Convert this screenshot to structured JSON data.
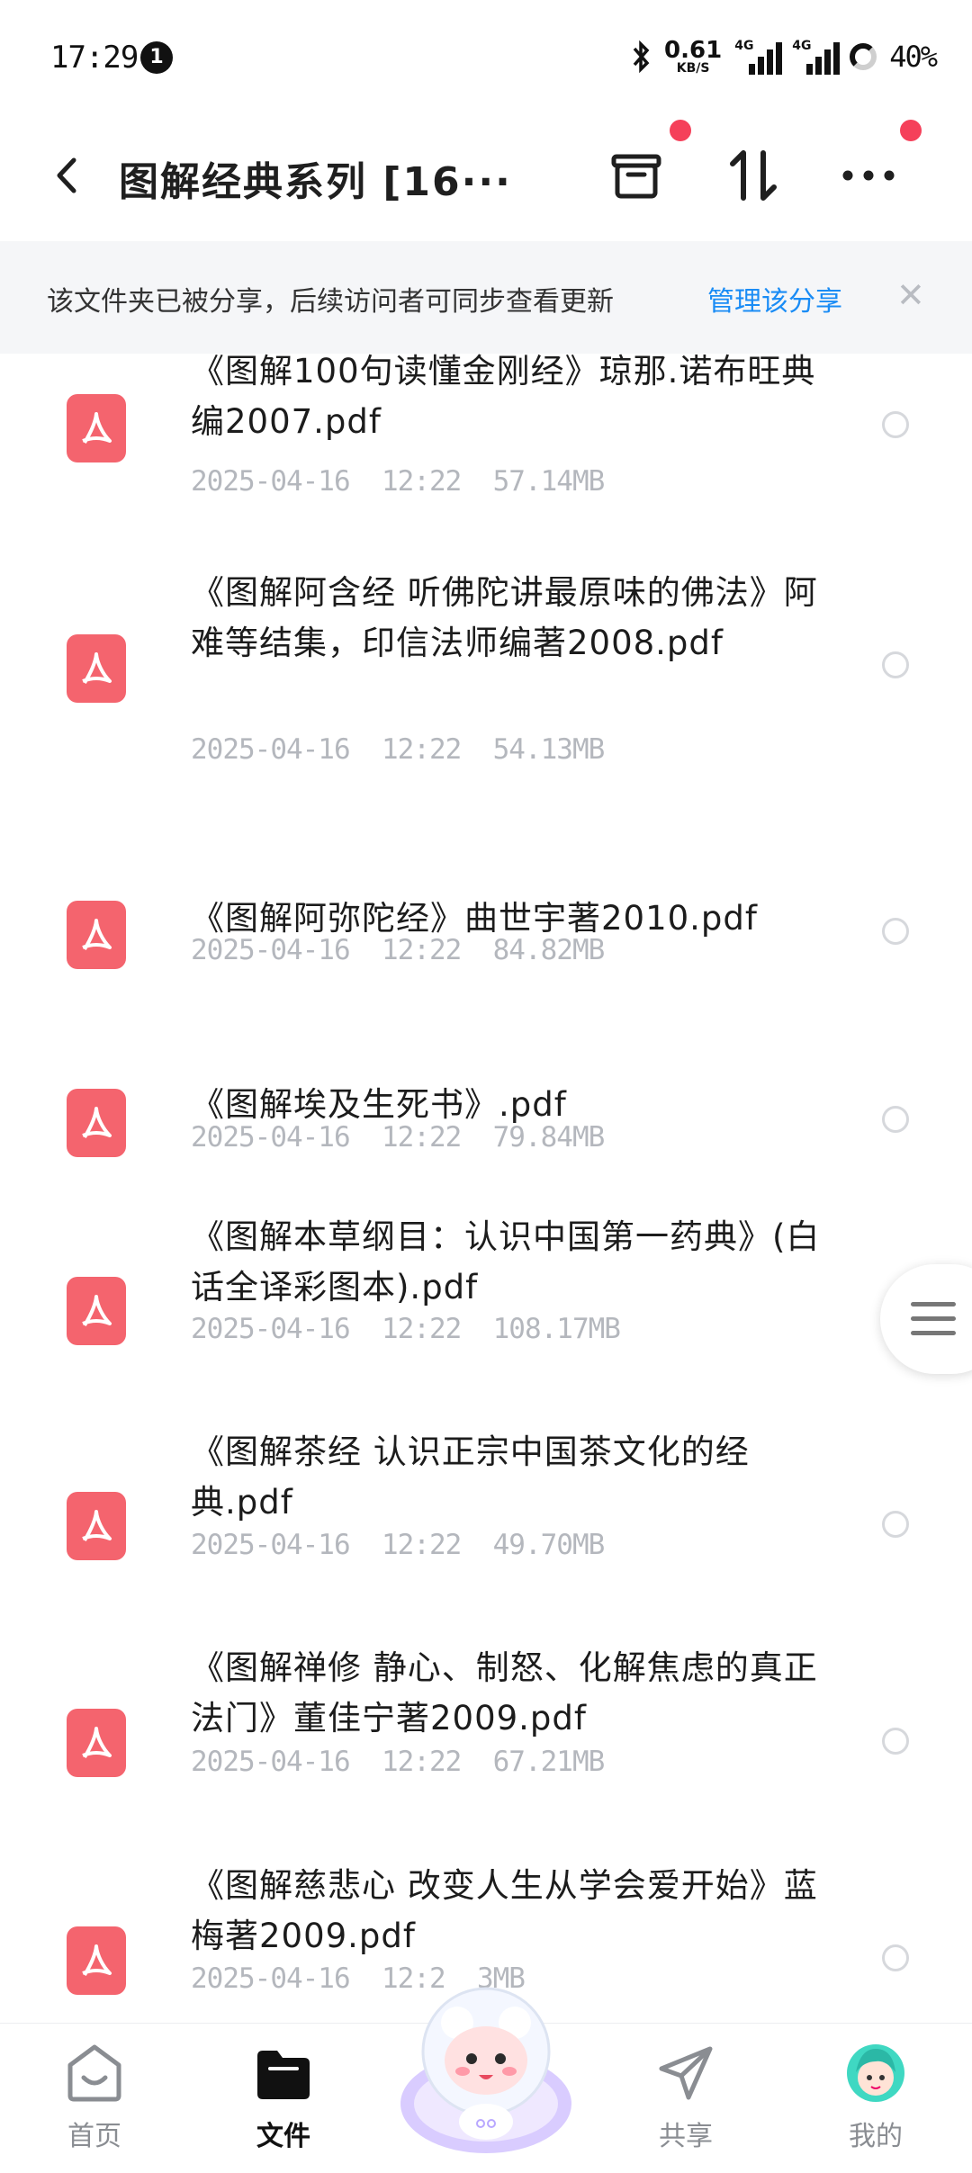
{
  "status_bar": {
    "time": "17:29",
    "notification_count": "1",
    "net_speed_value": "0.61",
    "net_speed_unit": "KB/S",
    "signal1_label": "4G",
    "signal2_label": "4G",
    "battery": "40%"
  },
  "header": {
    "title": "图解经典系列 [16···",
    "icons": [
      "back-icon",
      "archive-icon",
      "sort-icon",
      "more-icon"
    ]
  },
  "share_banner": {
    "text": "该文件夹已被分享，后续访问者可同步查看更新",
    "link": "管理该分享"
  },
  "files": [
    {
      "name": "《图解100句读懂金刚经》琼那.诺布旺典编2007.pdf",
      "date": "2025-04-16",
      "time": "12:22",
      "size": "57.14MB"
    },
    {
      "name": "《图解阿含经 听佛陀讲最原味的佛法》阿难等结集，印信法师编著2008.pdf",
      "date": "2025-04-16",
      "time": "12:22",
      "size": "54.13MB"
    },
    {
      "name": "《图解阿弥陀经》曲世宇著2010.pdf",
      "date": "2025-04-16",
      "time": "12:22",
      "size": "84.82MB"
    },
    {
      "name": "《图解埃及生死书》.pdf",
      "date": "2025-04-16",
      "time": "12:22",
      "size": "79.84MB"
    },
    {
      "name": "《图解本草纲目：认识中国第一药典》(白话全译彩图本).pdf",
      "date": "2025-04-16",
      "time": "12:22",
      "size": "108.17MB"
    },
    {
      "name": "《图解茶经 认识正宗中国茶文化的经典.pdf",
      "date": "2025-04-16",
      "time": "12:22",
      "size": "49.70MB"
    },
    {
      "name": "《图解禅修 静心、制怒、化解焦虑的真正法门》董佳宁著2009.pdf",
      "date": "2025-04-16",
      "time": "12:22",
      "size": "67.21MB"
    },
    {
      "name": "《图解慈悲心 改变人生从学会爱开始》蓝梅著2009.pdf",
      "date": "2025-04-16",
      "time": "12:2",
      "size": "3MB"
    }
  ],
  "bottom_nav": {
    "items": [
      {
        "label": "首页",
        "icon": "home-icon"
      },
      {
        "label": "文件",
        "icon": "folder-icon"
      },
      {
        "label": "共享",
        "icon": "share-icon"
      },
      {
        "label": "我的",
        "icon": "avatar-icon"
      }
    ],
    "active": "文件"
  },
  "colors": {
    "accent_link": "#1a8cf5",
    "pdf_icon": "#f4646e",
    "badge_red": "#f5405a",
    "meta_gray": "#b4b7bd"
  }
}
